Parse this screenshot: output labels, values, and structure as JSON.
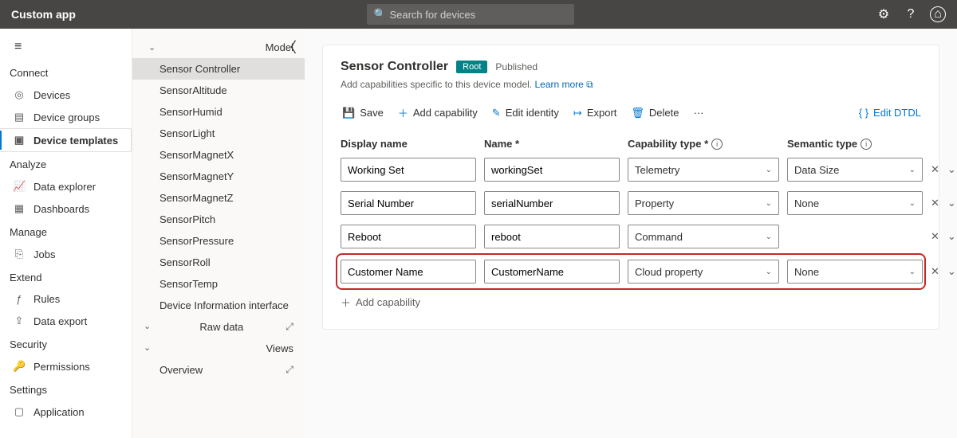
{
  "topbar": {
    "title": "Custom app",
    "search_placeholder": "Search for devices",
    "gear": "⚙",
    "help": "?",
    "profile_glyph": "⌂"
  },
  "nav": {
    "hamburger": "≡",
    "sections": {
      "connect": "Connect",
      "analyze": "Analyze",
      "manage": "Manage",
      "extend": "Extend",
      "security": "Security",
      "settings": "Settings"
    },
    "items": {
      "devices": "Devices",
      "device_groups": "Device groups",
      "device_templates": "Device templates",
      "data_explorer": "Data explorer",
      "dashboards": "Dashboards",
      "jobs": "Jobs",
      "rules": "Rules",
      "data_export": "Data export",
      "permissions": "Permissions",
      "application": "Application"
    }
  },
  "tree": {
    "model": "Model",
    "items": [
      "Sensor Controller",
      "SensorAltitude",
      "SensorHumid",
      "SensorLight",
      "SensorMagnetX",
      "SensorMagnetY",
      "SensorMagnetZ",
      "SensorPitch",
      "SensorPressure",
      "SensorRoll",
      "SensorTemp",
      "Device Information interface"
    ],
    "raw_data": "Raw data",
    "views": "Views",
    "overview": "Overview"
  },
  "main": {
    "title": "Sensor Controller",
    "badge": "Root",
    "status": "Published",
    "sub_text": "Add capabilities specific to this device model.",
    "learn_more": "Learn more",
    "cmd": {
      "save": "Save",
      "add_capability": "Add capability",
      "edit_identity": "Edit identity",
      "export": "Export",
      "delete": "Delete",
      "more": "···",
      "edit_dtdl": "Edit DTDL"
    },
    "headers": {
      "display_name": "Display name",
      "name": "Name *",
      "capability_type": "Capability type *",
      "semantic_type": "Semantic type"
    },
    "rows": [
      {
        "display": "Working Set",
        "name": "workingSet",
        "cap": "Telemetry",
        "sem": "Data Size",
        "has_sem": true
      },
      {
        "display": "Serial Number",
        "name": "serialNumber",
        "cap": "Property",
        "sem": "None",
        "has_sem": true
      },
      {
        "display": "Reboot",
        "name": "reboot",
        "cap": "Command",
        "sem": "",
        "has_sem": false
      },
      {
        "display": "Customer Name",
        "name": "CustomerName",
        "cap": "Cloud property",
        "sem": "None",
        "has_sem": true
      }
    ],
    "add_capability_row": "Add capability"
  }
}
